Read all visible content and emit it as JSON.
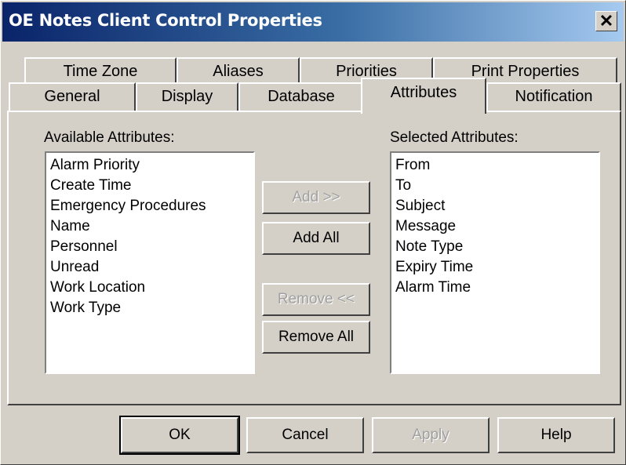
{
  "window": {
    "title": "OE Notes Client Control Properties",
    "close_glyph": "✕"
  },
  "tabs": {
    "row1": [
      "Time Zone",
      "Aliases",
      "Priorities",
      "Print Properties"
    ],
    "row2": [
      "General",
      "Display",
      "Database",
      "Attributes",
      "Notification"
    ],
    "active": "Attributes"
  },
  "available": {
    "label": "Available Attributes:",
    "items": [
      "Alarm Priority",
      "Create Time",
      "Emergency Procedures",
      "Name",
      "Personnel",
      "Unread",
      "Work Location",
      "Work Type"
    ]
  },
  "selected": {
    "label": "Selected Attributes:",
    "items": [
      "From",
      "To",
      "Subject",
      "Message",
      "Note Type",
      "Expiry Time",
      "Alarm Time"
    ]
  },
  "buttons": {
    "add": "Add >>",
    "add_all": "Add All",
    "remove": "Remove <<",
    "remove_all": "Remove All"
  },
  "footer": {
    "ok": "OK",
    "cancel": "Cancel",
    "apply": "Apply",
    "help": "Help"
  }
}
